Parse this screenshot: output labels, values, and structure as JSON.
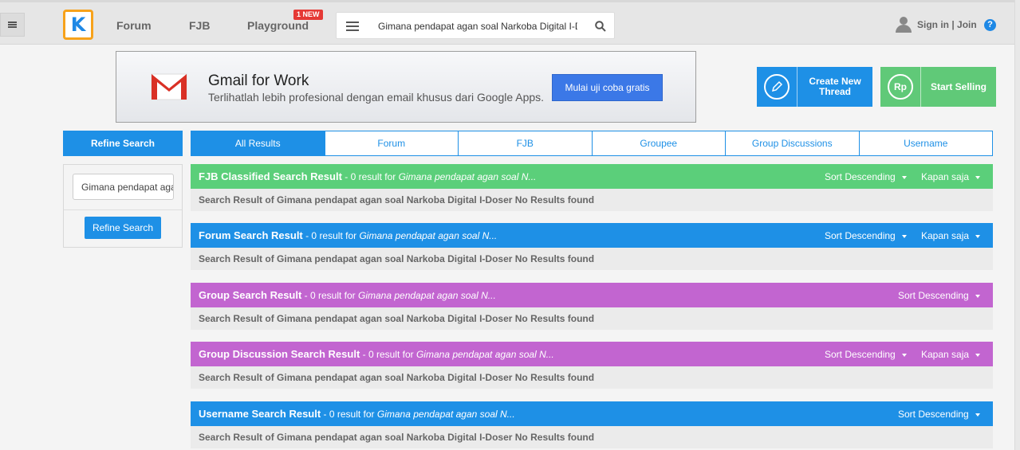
{
  "header": {
    "nav": [
      "Forum",
      "FJB",
      "Playground"
    ],
    "new_badge": "1 NEW",
    "search_value": "Gimana pendapat agan soal Narkoba Digital I-Doser",
    "sign_in": "Sign in | Join",
    "help": "?"
  },
  "ad": {
    "title": "Gmail for Work",
    "subtitle": "Terlihatlah lebih profesional dengan email khusus dari Google Apps.",
    "button": "Mulai uji coba gratis"
  },
  "actions": {
    "create_line1": "Create New",
    "create_line2": "Thread",
    "sell": "Start Selling",
    "sell_icon": "Rp"
  },
  "sidebar": {
    "header": "Refine Search",
    "input_value": "Gimana pendapat agan soal Narkoba Digital I-Doser",
    "button": "Refine Search"
  },
  "tabs": [
    "All Results",
    "Forum",
    "FJB",
    "Groupee",
    "Group Discussions",
    "Username"
  ],
  "common": {
    "result_prefix": " - 0 result for ",
    "query_short": "Gimana pendapat agan soal N...",
    "sort_desc": "Sort Descending",
    "kapan": "Kapan saja",
    "no_results": "Search Result of Gimana pendapat agan soal Narkoba Digital I-Doser No Results found"
  },
  "sections": [
    {
      "title": "FJB Classified Search Result"
    },
    {
      "title": "Forum Search Result"
    },
    {
      "title": "Group Search Result"
    },
    {
      "title": "Group Discussion Search Result"
    },
    {
      "title": "Username Search Result"
    }
  ],
  "colors": {
    "primary_blue": "#1e90e6",
    "green": "#5bcf7a",
    "purple": "#c265d0",
    "logo_orange": "#f7a21b"
  }
}
